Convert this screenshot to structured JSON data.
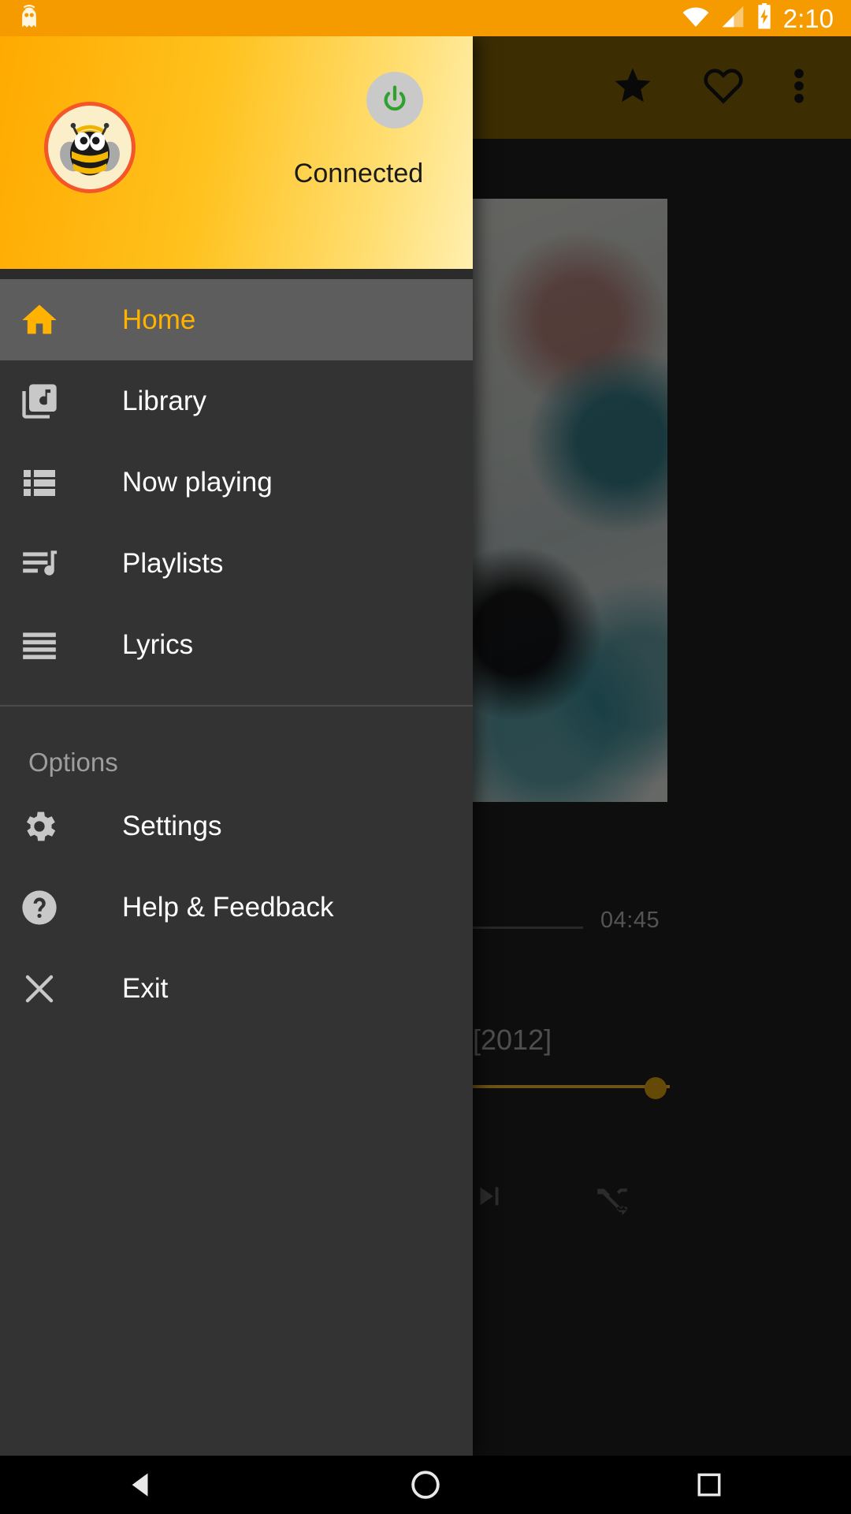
{
  "status_bar": {
    "notification_icon": "ghost-notification-icon",
    "wifi_icon": "wifi-icon",
    "signal_icon": "cell-signal-icon",
    "battery_icon": "battery-charging-icon",
    "clock": "2:10",
    "background_color": "#F59B00"
  },
  "drawer": {
    "header": {
      "avatar_icon": "bee-avatar-icon",
      "power_button_icon": "power-icon",
      "power_button_color": "#2EA12E",
      "connection_status": "Connected",
      "background_start_color": "#FFAA00",
      "background_end_color": "#FFEFAF"
    },
    "nav_items": [
      {
        "label": "Home",
        "icon": "home-icon",
        "selected": true
      },
      {
        "label": "Library",
        "icon": "library-music-icon",
        "selected": false
      },
      {
        "label": "Now playing",
        "icon": "queue-list-icon",
        "selected": false
      },
      {
        "label": "Playlists",
        "icon": "playlist-music-icon",
        "selected": false
      },
      {
        "label": "Lyrics",
        "icon": "lyrics-lines-icon",
        "selected": false
      }
    ],
    "options_section": {
      "title": "Options",
      "items": [
        {
          "label": "Settings",
          "icon": "gear-icon"
        },
        {
          "label": "Help & Feedback",
          "icon": "help-icon"
        },
        {
          "label": "Exit",
          "icon": "close-x-icon"
        }
      ]
    },
    "selected_color": "#FFB300",
    "background_color": "#333333"
  },
  "player": {
    "toolbar": {
      "favorite_icon": "star-icon",
      "like_icon": "heart-outline-icon",
      "overflow_icon": "more-vertical-icon"
    },
    "album_art_icon": "album-art-image",
    "total_time": "04:45",
    "year": "[2012]",
    "next_icon": "skip-next-icon",
    "shuffle_icon": "shuffle-icon",
    "accent_color": "#C9972A"
  },
  "system_nav": {
    "back_icon": "back-triangle-icon",
    "home_icon": "home-circle-icon",
    "recents_icon": "recents-square-icon"
  }
}
